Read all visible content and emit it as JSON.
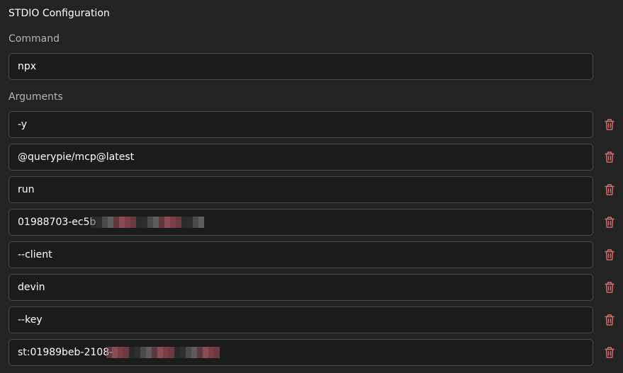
{
  "section": {
    "title": "STDIO Configuration"
  },
  "command": {
    "label": "Command",
    "value": "npx"
  },
  "arguments": {
    "label": "Arguments",
    "items": [
      {
        "value": "-y"
      },
      {
        "value": "@querypie/mcp@latest"
      },
      {
        "value": "run"
      },
      {
        "value": "01988703-ec5b-",
        "redacted": true
      },
      {
        "value": "--client"
      },
      {
        "value": "devin"
      },
      {
        "value": "--key"
      },
      {
        "value": "st:01989beb-2108-",
        "redacted": true
      }
    ]
  },
  "icons": {
    "delete": "trash-icon"
  },
  "colors": {
    "background": "#232323",
    "input_background": "#1b1b1b",
    "input_border": "#4a4a4a",
    "delete_icon": "#e06c6c",
    "label": "#b4b4b4"
  }
}
